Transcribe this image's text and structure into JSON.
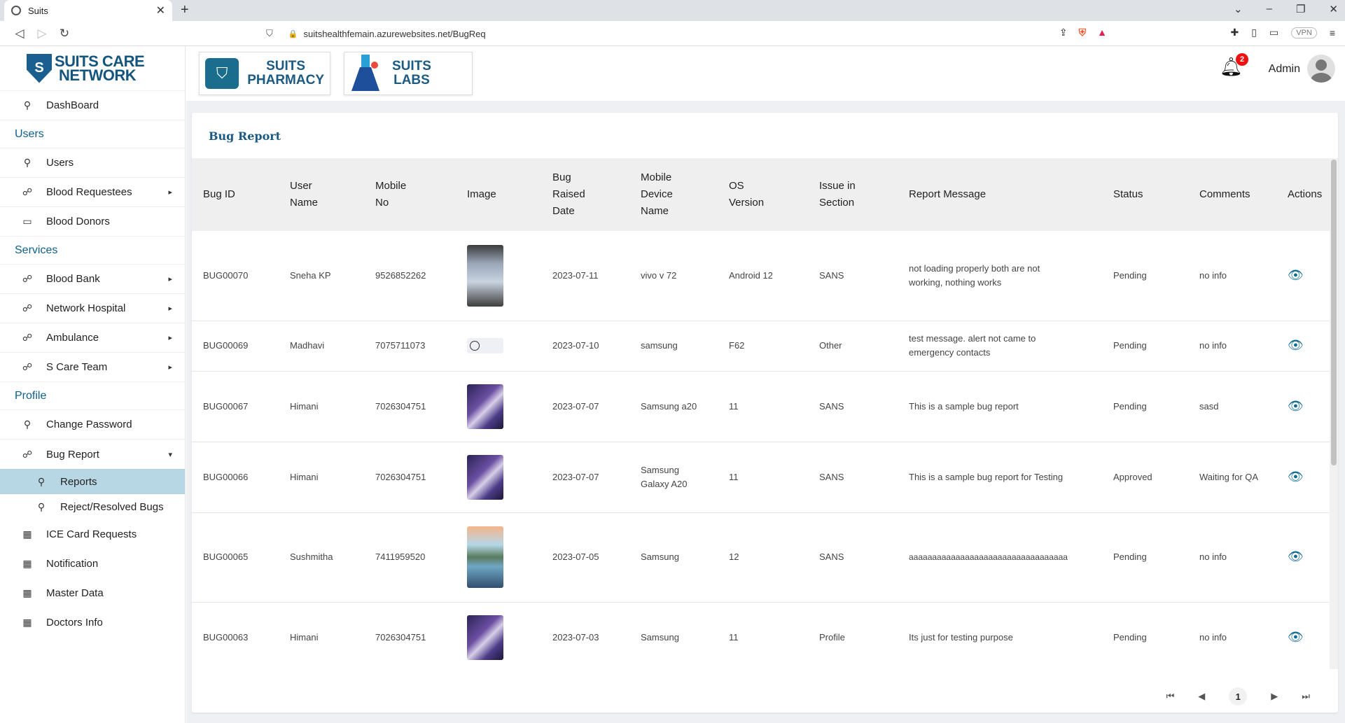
{
  "browser": {
    "tab_title": "Suits",
    "url": "suitshealthfemain.azurewebsites.net/BugReq",
    "vpn_label": "VPN"
  },
  "sidebar": {
    "logo_line1": "SUITS CARE",
    "logo_line2": "NETWORK",
    "dashboard": "DashBoard",
    "section_users": "Users",
    "users": "Users",
    "blood_requestees": "Blood Requestees",
    "blood_donors": "Blood Donors",
    "section_services": "Services",
    "blood_bank": "Blood Bank",
    "network_hospital": "Network Hospital",
    "ambulance": "Ambulance",
    "scare_team": "S Care Team",
    "section_profile": "Profile",
    "change_password": "Change Password",
    "bug_report": "Bug Report",
    "reports": "Reports",
    "reject_resolved": "Reject/Resolved Bugs",
    "ice_card": "ICE Card Requests",
    "notification": "Notification",
    "master_data": "Master Data",
    "doctors_info": "Doctors Info"
  },
  "header": {
    "pharmacy_line1": "SUITS",
    "pharmacy_line2": "PHARMACY",
    "labs_line1": "SUITS",
    "labs_line2": "LABS",
    "notification_count": "2",
    "user_name": "Admin"
  },
  "page": {
    "title": "Bug Report"
  },
  "table": {
    "headers": {
      "bug_id": "Bug ID",
      "user_name_1": "User",
      "user_name_2": "Name",
      "mobile_1": "Mobile",
      "mobile_2": "No",
      "image": "Image",
      "date_1": "Bug",
      "date_2": "Raised",
      "date_3": "Date",
      "device_1": "Mobile",
      "device_2": "Device",
      "device_3": "Name",
      "os_1": "OS",
      "os_2": "Version",
      "issue_1": "Issue in",
      "issue_2": "Section",
      "message": "Report Message",
      "status": "Status",
      "comments": "Comments",
      "actions": "Actions"
    },
    "rows": [
      {
        "id": "BUG00070",
        "user": "Sneha KP",
        "mobile": "9526852262",
        "date": "2023-07-11",
        "device": "vivo v 72",
        "os": "Android 12",
        "section": "SANS",
        "message": "not loading properly both are not working, nothing works",
        "status": "Pending",
        "comments": "no info"
      },
      {
        "id": "BUG00069",
        "user": "Madhavi",
        "mobile": "7075711073",
        "date": "2023-07-10",
        "device": "samsung",
        "os": "F62",
        "section": "Other",
        "message": "test message. alert not came to emergency contacts",
        "status": "Pending",
        "comments": "no info"
      },
      {
        "id": "BUG00067",
        "user": "Himani",
        "mobile": "7026304751",
        "date": "2023-07-07",
        "device": "Samsung a20",
        "os": "11",
        "section": "SANS",
        "message": "This is a sample bug report",
        "status": "Pending",
        "comments": "sasd"
      },
      {
        "id": "BUG00066",
        "user": "Himani",
        "mobile": "7026304751",
        "date": "2023-07-07",
        "device": "Samsung Galaxy A20",
        "os": "11",
        "section": "SANS",
        "message": "This is a sample bug report for Testing",
        "status": "Approved",
        "comments": "Waiting for QA"
      },
      {
        "id": "BUG00065",
        "user": "Sushmitha",
        "mobile": "7411959520",
        "date": "2023-07-05",
        "device": "Samsung",
        "os": "12",
        "section": "SANS",
        "message": "aaaaaaaaaaaaaaaaaaaaaaaaaaaaaaaaaa",
        "status": "Pending",
        "comments": "no info"
      },
      {
        "id": "BUG00063",
        "user": "Himani",
        "mobile": "7026304751",
        "date": "2023-07-03",
        "device": "Samsung",
        "os": "11",
        "section": "Profile",
        "message": "Its just for testing purpose",
        "status": "Pending",
        "comments": "no info"
      }
    ]
  },
  "pagination": {
    "current_page": "1"
  }
}
